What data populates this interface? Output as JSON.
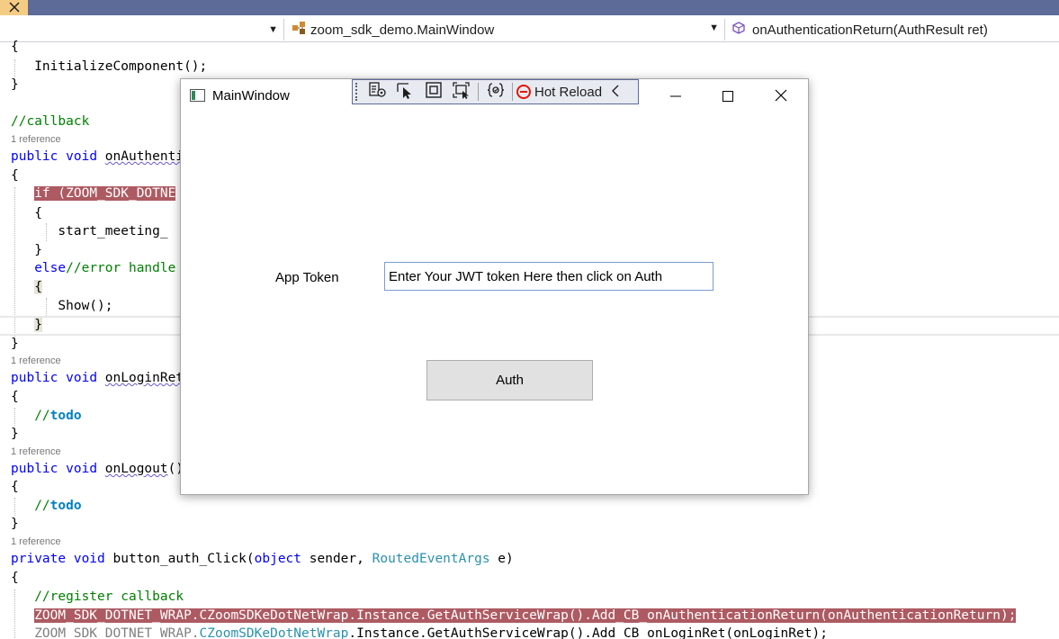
{
  "navbar": {
    "class_dropdown": "zoom_sdk_demo.MainWindow",
    "member_dropdown": "onAuthenticationReturn(AuthResult ret)"
  },
  "code": {
    "ref": "1 reference",
    "l1": "{",
    "l2": "InitializeComponent();",
    "l3": "}",
    "l4": "//callback",
    "l5_kw1": "public",
    "l5_kw2": "void",
    "l5_name": "onAuthenti",
    "l6": "{",
    "l7_kw": "if",
    "l7_rest": " (ZOOM_SDK_DOTNE",
    "l8": "{",
    "l9": "start_meeting_",
    "l10": "}",
    "l11_kw": "else",
    "l11_cm": "//error handle",
    "l12": "{",
    "l13": "Show();",
    "l14": "}",
    "l15": "}",
    "l16_kw1": "public",
    "l16_kw2": "void",
    "l16_name": "onLoginRet",
    "l17": "{",
    "l18_cm": "//",
    "l18_todo": "todo",
    "l19": "}",
    "l20_kw1": "public",
    "l20_kw2": "void",
    "l20_name": "onLogout",
    "l20_rest": "()",
    "l21": "{",
    "l22_cm": "//",
    "l22_todo": "todo",
    "l23": "}",
    "l24_kw1": "private",
    "l24_kw2": "void",
    "l24_name": "button_auth_Click",
    "l24_kw3": "object",
    "l24_p1": " sender, ",
    "l24_type": "RoutedEventArgs",
    "l24_p2": " e)",
    "l25": "{",
    "l26": "//register callback",
    "l27": "ZOOM_SDK_DOTNET_WRAP.CZoomSDKeDotNetWrap.Instance.GetAuthServiceWrap().Add_CB_onAuthenticationReturn(onAuthenticationReturn);",
    "l28_a": "ZOOM_SDK_DOTNET_WRAP.",
    "l28_b": "CZoomSDKeDotNetWrap",
    "l28_c": ".Instance.GetAuthServiceWrap().Add_CB_onLoginRet(onLoginRet);"
  },
  "window": {
    "title": "MainWindow",
    "hot_reload_label": "Hot Reload",
    "app_token_label": "App Token",
    "token_value": "Enter Your JWT token Here then click on Auth",
    "auth_label": "Auth"
  }
}
